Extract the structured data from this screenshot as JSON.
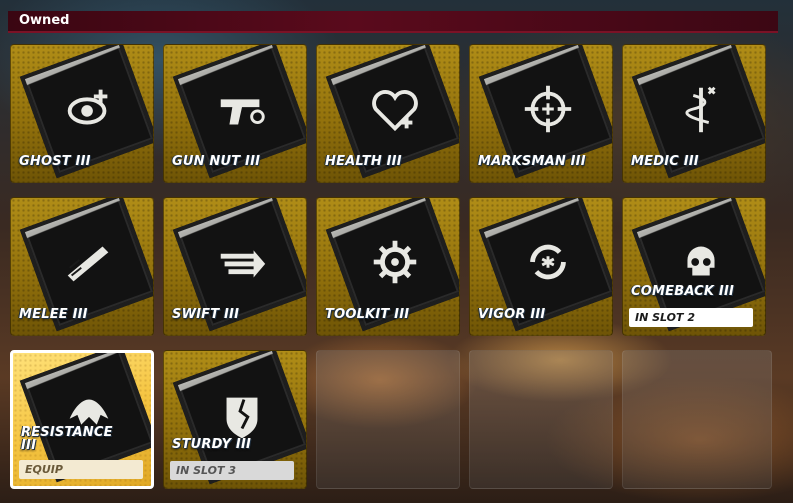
{
  "header": {
    "title": "Owned"
  },
  "perks": [
    {
      "label": "GHOST III",
      "icon": "ghost-eye-icon",
      "status": ""
    },
    {
      "label": "GUN NUT III",
      "icon": "pistol-icon",
      "status": ""
    },
    {
      "label": "HEALTH III",
      "icon": "heart-icon",
      "status": ""
    },
    {
      "label": "MARKSMAN III",
      "icon": "crosshair-icon",
      "status": ""
    },
    {
      "label": "MEDIC III",
      "icon": "caduceus-icon",
      "status": ""
    },
    {
      "label": "MELEE III",
      "icon": "blade-icon",
      "status": ""
    },
    {
      "label": "SWIFT III",
      "icon": "speed-arrow-icon",
      "status": ""
    },
    {
      "label": "TOOLKIT III",
      "icon": "gear-icon",
      "status": ""
    },
    {
      "label": "VIGOR III",
      "icon": "cycle-icon",
      "status": ""
    },
    {
      "label": "COMEBACK III",
      "icon": "skull-icon",
      "status": "IN SLOT 2"
    },
    {
      "label": "RESISTANCE III",
      "icon": "shield-wings-icon",
      "status": "EQUIP"
    },
    {
      "label": "STURDY III",
      "icon": "cracked-shield-icon",
      "status": "IN SLOT 3"
    }
  ]
}
